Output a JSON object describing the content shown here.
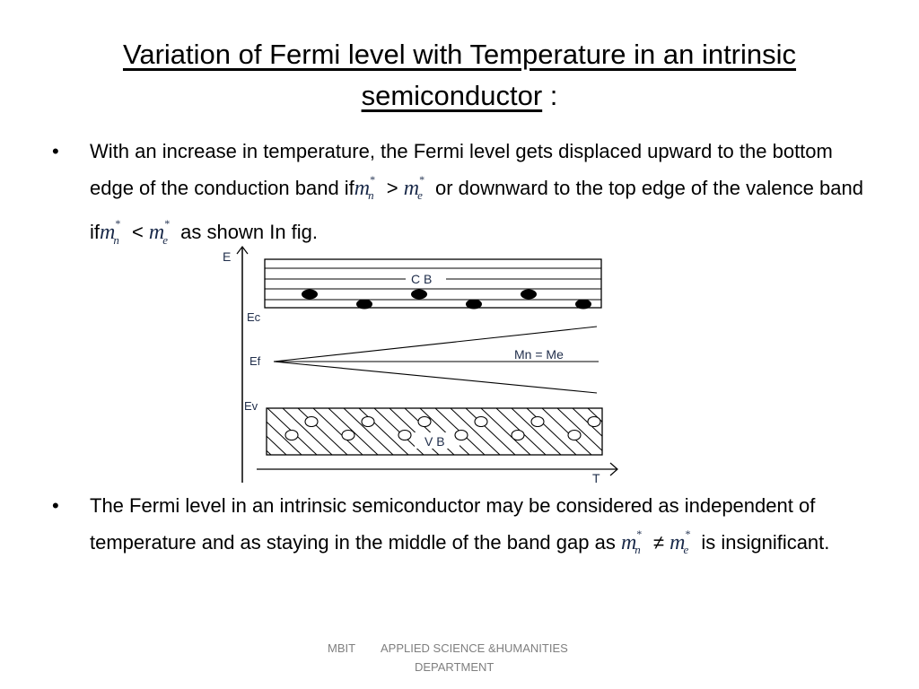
{
  "slide": {
    "title_main": "Variation of Fermi level with Temperature in an intrinsic",
    "title_line2": "semiconductor",
    "title_suffix": " :",
    "bullet_char": "•",
    "bullet1": {
      "part1": "With an increase in temperature, the Fermi level gets displaced upward to the bottom edge of the conduction band if",
      "mn_1": "m",
      "op1": " > ",
      "me_1": "m",
      "part2": "  or downward to the top edge of the valence band if",
      "op2": " < ",
      "part3": " as shown In fig."
    },
    "bullet2": {
      "part1": "The Fermi level in an intrinsic semiconductor may be considered as independent of temperature and as staying in the middle of the band gap as ",
      "op": " ≠ ",
      "part2": "  is insignificant."
    },
    "mass_symbols": {
      "base": "m",
      "star": "*",
      "sub_n": "n",
      "sub_e": "e"
    },
    "footer": {
      "org": "MBIT",
      "dept_line1": "APPLIED SCIENCE &HUMANITIES",
      "dept_line2": "DEPARTMENT"
    }
  },
  "diagram": {
    "axis_y_label": "E",
    "axis_x_label": "T",
    "conduction_band_label": "C B",
    "valence_band_label": "V B",
    "ec_label": "Ec",
    "ef_label": "Ef",
    "ev_label": "Ev",
    "equal_mass_label": "Mn = Me",
    "electron_count": 6,
    "hole_count": 12,
    "colors": {
      "line": "#000000",
      "label": "#1f2d4a"
    }
  }
}
